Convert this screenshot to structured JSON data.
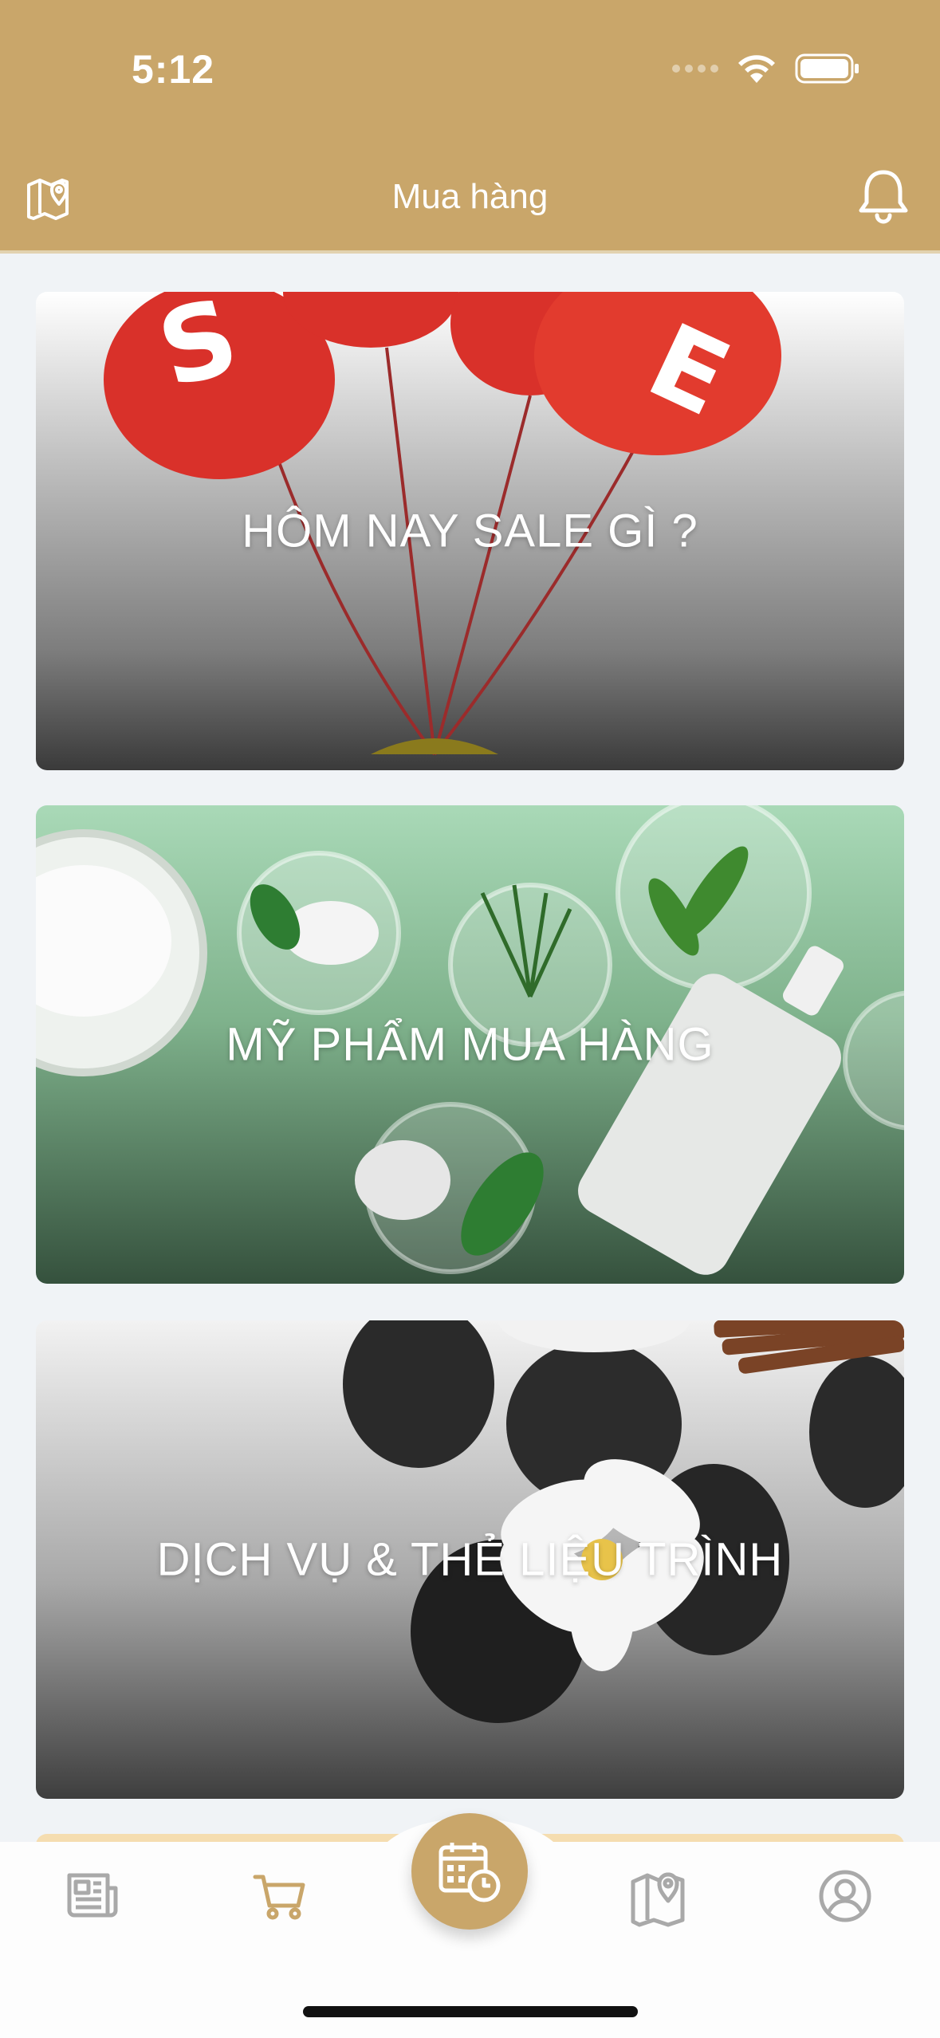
{
  "status_bar": {
    "time": "5:12"
  },
  "header": {
    "title": "Mua hàng"
  },
  "cards": [
    {
      "label": "HÔM NAY SALE GÌ ?"
    },
    {
      "label": "MỸ PHẨM MUA HÀNG"
    },
    {
      "label": "DỊCH VỤ & THẺ LIỆU TRÌNH"
    }
  ],
  "tabbar": {
    "items": [
      {
        "icon": "news-icon",
        "active": false
      },
      {
        "icon": "cart-icon",
        "active": true
      },
      {
        "icon": "calendar-clock-icon",
        "center": true
      },
      {
        "icon": "map-pin-icon",
        "active": false
      },
      {
        "icon": "user-circle-icon",
        "active": false
      }
    ]
  },
  "colors": {
    "brand": "#c9a66a",
    "background": "#f0f3f6",
    "tab_inactive": "#a9a9a9"
  }
}
